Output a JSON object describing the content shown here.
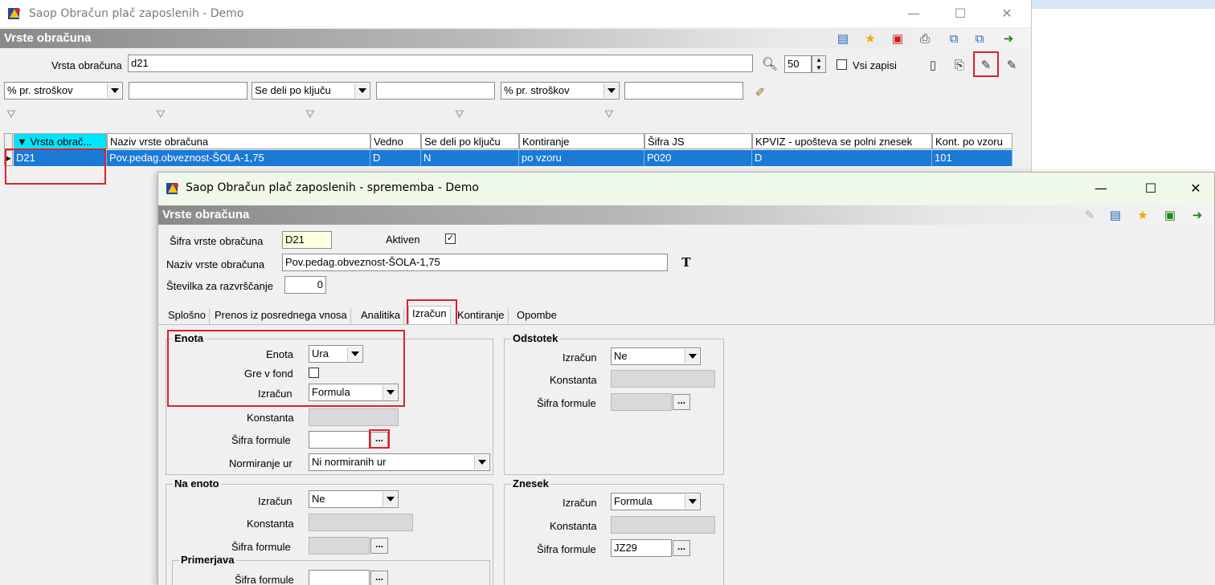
{
  "main": {
    "title": "Saop Obračun plač zaposlenih - Demo",
    "section": "Vrste obračuna",
    "search_label": "Vrsta obračuna",
    "search_value": "d21",
    "page_size": "50",
    "all_records_label": "Vsi zapisi",
    "filters": [
      "% pr. stroškov",
      "Se deli po ključu",
      "% pr. stroškov"
    ],
    "columns": [
      "Vrsta obrač...",
      "Naziv vrste obračuna",
      "Vedno",
      "Se deli po ključu",
      "Kontiranje",
      "Šifra JS",
      "KPVIZ - upošteva se polni znesek",
      "Kont. po vzoru"
    ],
    "row": [
      "D21",
      "Pov.pedag.obveznost-ŠOLA-1,75",
      "D",
      "N",
      "po vzoru",
      "P020",
      "D",
      "101"
    ]
  },
  "dialog": {
    "title": "Saop Obračun plač zaposlenih - sprememba - Demo",
    "section": "Vrste obračuna",
    "code_label": "Šifra vrste obračuna",
    "code_value": "D21",
    "active_label": "Aktiven",
    "active_check": "✓",
    "name_label": "Naziv vrste obračuna",
    "name_value": "Pov.pedag.obveznost-ŠOLA-1,75",
    "sort_label": "Številka  za razvrščanje",
    "sort_value": "0",
    "tabs": [
      "Splošno",
      "Prenos iz posrednega vnosa",
      "Analitika",
      "Izračun",
      "Kontiranje",
      "Opombe"
    ],
    "enota": {
      "title": "Enota",
      "unit_label": "Enota",
      "unit_value": "Ura",
      "fund_label": "Gre v fond",
      "calc_label": "Izračun",
      "calc_value": "Formula",
      "const_label": "Konstanta",
      "formula_label": "Šifra formule",
      "norm_label": "Normiranje ur",
      "norm_value": "Ni normiranih ur"
    },
    "odstotek": {
      "title": "Odstotek",
      "calc_label": "Izračun",
      "calc_value": "Ne",
      "const_label": "Konstanta",
      "formula_label": "Šifra formule"
    },
    "na_enoto": {
      "title": "Na enoto",
      "calc_label": "Izračun",
      "calc_value": "Ne",
      "const_label": "Konstanta",
      "formula_label": "Šifra formule"
    },
    "primerjava": {
      "title": "Primerjava",
      "formula_label": "Šifra formule"
    },
    "znesek": {
      "title": "Znesek",
      "calc_label": "Izračun",
      "calc_value": "Formula",
      "const_label": "Konstanta",
      "formula_label": "Šifra formule",
      "formula_value": "JZ29"
    },
    "ellipsis": "...",
    "text_tool": "T"
  },
  "colors": {
    "accent": "#1b7ad6",
    "highlight": "#e0202a",
    "header_cyan": "#00e5ff"
  }
}
